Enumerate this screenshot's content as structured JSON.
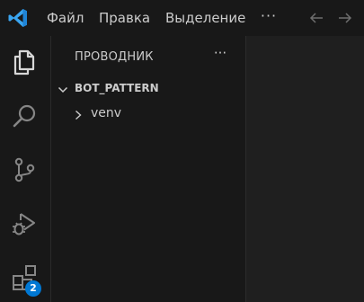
{
  "titlebar": {
    "app_icon": "vscode-logo-icon",
    "menu": [
      "Файл",
      "Правка",
      "Выделение"
    ],
    "more": "···",
    "nav": [
      "arrow-left-icon",
      "arrow-right-icon"
    ]
  },
  "activitybar": {
    "items": [
      "explorer-icon",
      "search-icon",
      "source-control-icon",
      "run-debug-icon",
      "extensions-icon"
    ],
    "extensions_badge": "2"
  },
  "sidebar": {
    "title": "ПРОВОДНИК",
    "more": "···",
    "folder": {
      "name": "BOT_PATTERN",
      "expanded": true
    },
    "tree": [
      {
        "label": "venv",
        "type": "folder",
        "expanded": false
      }
    ]
  },
  "colors": {
    "background": "#1f1f1f",
    "bars": "#181818",
    "text": "#cccccc",
    "accent_badge": "#0078d4"
  }
}
